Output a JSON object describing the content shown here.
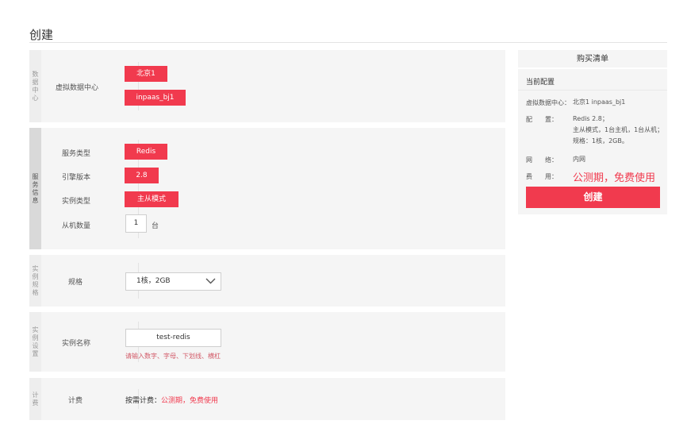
{
  "page": {
    "title": "创建"
  },
  "sections": {
    "datacenter": {
      "side_label": "数据中心",
      "field_label": "虚拟数据中心",
      "region_button": "北京1",
      "zone_button": "inpaas_bj1"
    },
    "service": {
      "side_label": "服务信息",
      "type_label": "服务类型",
      "type_value": "Redis",
      "engine_label": "引擎版本",
      "engine_value": "2.8",
      "instance_type_label": "实例类型",
      "instance_type_value": "主从模式",
      "slave_count_label": "从机数量",
      "slave_count_value": "1",
      "slave_count_unit": "台"
    },
    "spec": {
      "side_label": "实例规格",
      "field_label": "规格",
      "select_value": "1核，2GB"
    },
    "settings": {
      "side_label": "实例设置",
      "field_label": "实例名称",
      "name_value": "test-redis",
      "hint": "请输入数字、字母、下划线、横杠"
    },
    "billing": {
      "side_label": "计费",
      "field_label": "计费",
      "mode_prefix": "按需计费：",
      "mode_value": "公测期，免费使用"
    }
  },
  "cart": {
    "title": "购买清单",
    "subtitle": "当前配置",
    "datacenter_key": "虚拟数据中心：",
    "datacenter_value": "北京1 inpaas_bj1",
    "config_key": "配　　置：",
    "config_line1": "Redis 2.8；",
    "config_line2": "主从模式，1台主机，1台从机；",
    "config_line3": "规格：1核，2GB。",
    "network_key": "网　　络：",
    "network_value": "内网",
    "fee_key": "费　　用：",
    "fee_value": "公测期，免费使用",
    "create_button": "创建"
  },
  "colors": {
    "accent": "#f13a4e",
    "panel": "#f5f5f5",
    "hint": "#d25a68"
  },
  "icons": {
    "select_arrow": "chevron-down-icon"
  }
}
